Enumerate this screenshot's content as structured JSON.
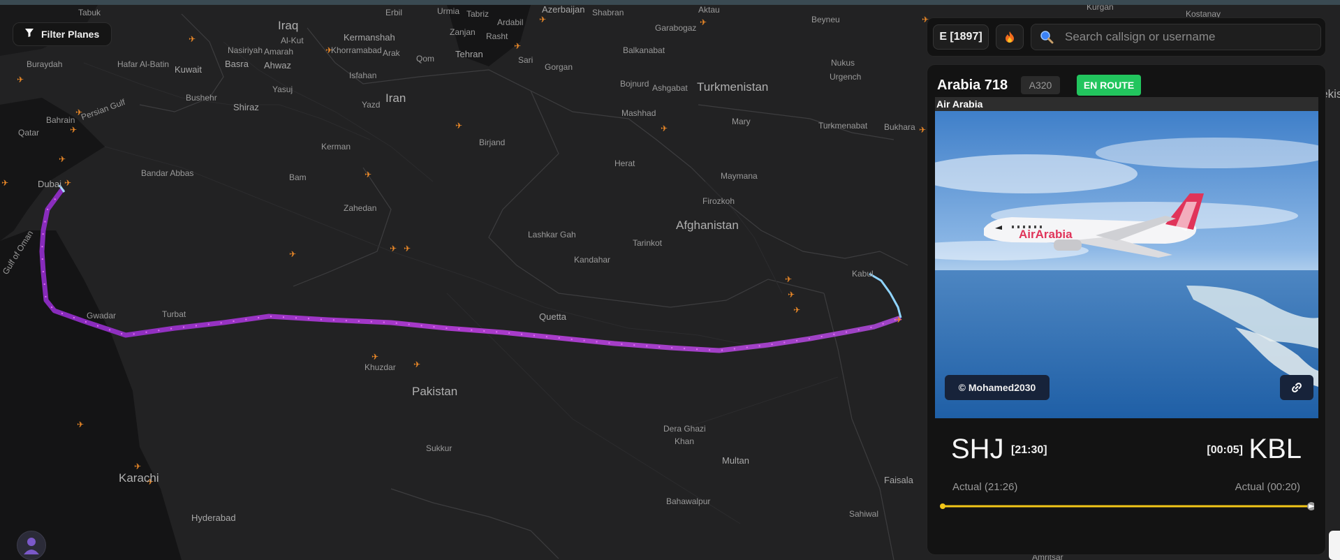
{
  "toolbar": {
    "filter_label": "Filter Planes",
    "server_label": "E [1897]",
    "search_placeholder": "Search callsign or username"
  },
  "map": {
    "labels": [
      "Tabuk",
      "Erbil",
      "Urmia",
      "Tabriz",
      "Ardabil",
      "Azerbaijan",
      "Shabran",
      "Aktau",
      "Beyneu",
      "Kurgan",
      "Kostanay",
      "Iraq",
      "Al-Kut",
      "Zanjan",
      "Rasht",
      "Garabogaz",
      "Kermanshah",
      "Khorramabad",
      "Arak",
      "Qom",
      "Tehran",
      "Sari",
      "Balkanabat",
      "Nasiriyah",
      "Amarah",
      "Buraydah",
      "Hafar Al-Batin",
      "Kuwait",
      "Basra",
      "Ahwaz",
      "Gorgan",
      "Nukus",
      "Isfahan",
      "Bojnurd",
      "Ashgabat",
      "Turkmenistan",
      "Urgench",
      "Uzbekis",
      "Yasuj",
      "Bushehr",
      "Yazd",
      "Iran",
      "Shiraz",
      "Bahrain",
      "Persian Gulf",
      "Qatar",
      "Mashhad",
      "Mary",
      "Turkmenabat",
      "Bukhara",
      "Birjand",
      "Kerman",
      "Dubai",
      "Bandar Abbas",
      "Herat",
      "Bam",
      "Maymana",
      "Gulf of Oman",
      "Zahedan",
      "Firozkoh",
      "Afghanistan",
      "Lashkar Gah",
      "Tarinkot",
      "Kandahar",
      "Kabul",
      "Gwadar",
      "Turbat",
      "Quetta",
      "Khuzdar",
      "Pakistan",
      "Dera Ghazi",
      "Khan",
      "Sukkur",
      "Multan",
      "Faisala",
      "Karachi",
      "Bahawalpur",
      "Hyderabad",
      "Sahiwal",
      "Amritsar"
    ]
  },
  "flight": {
    "callsign": "Arabia 718",
    "aircraft_type": "A320",
    "status": "EN ROUTE",
    "airline": "Air Arabia",
    "livery_text": "AirArabia",
    "photo_credit": "© Mohamed2030",
    "departure": {
      "code": "SHJ",
      "scheduled": "[21:30]",
      "actual": "Actual (21:26)"
    },
    "arrival": {
      "code": "KBL",
      "scheduled": "[00:05]",
      "actual": "Actual (00:20)"
    },
    "progress": 1.0
  },
  "colors": {
    "status_green": "#22c55e",
    "route_purple": "#c03fe8",
    "progress_yellow": "#f2c618",
    "aircraft_orange": "#f28c28",
    "credit_bg": "#17233a"
  }
}
